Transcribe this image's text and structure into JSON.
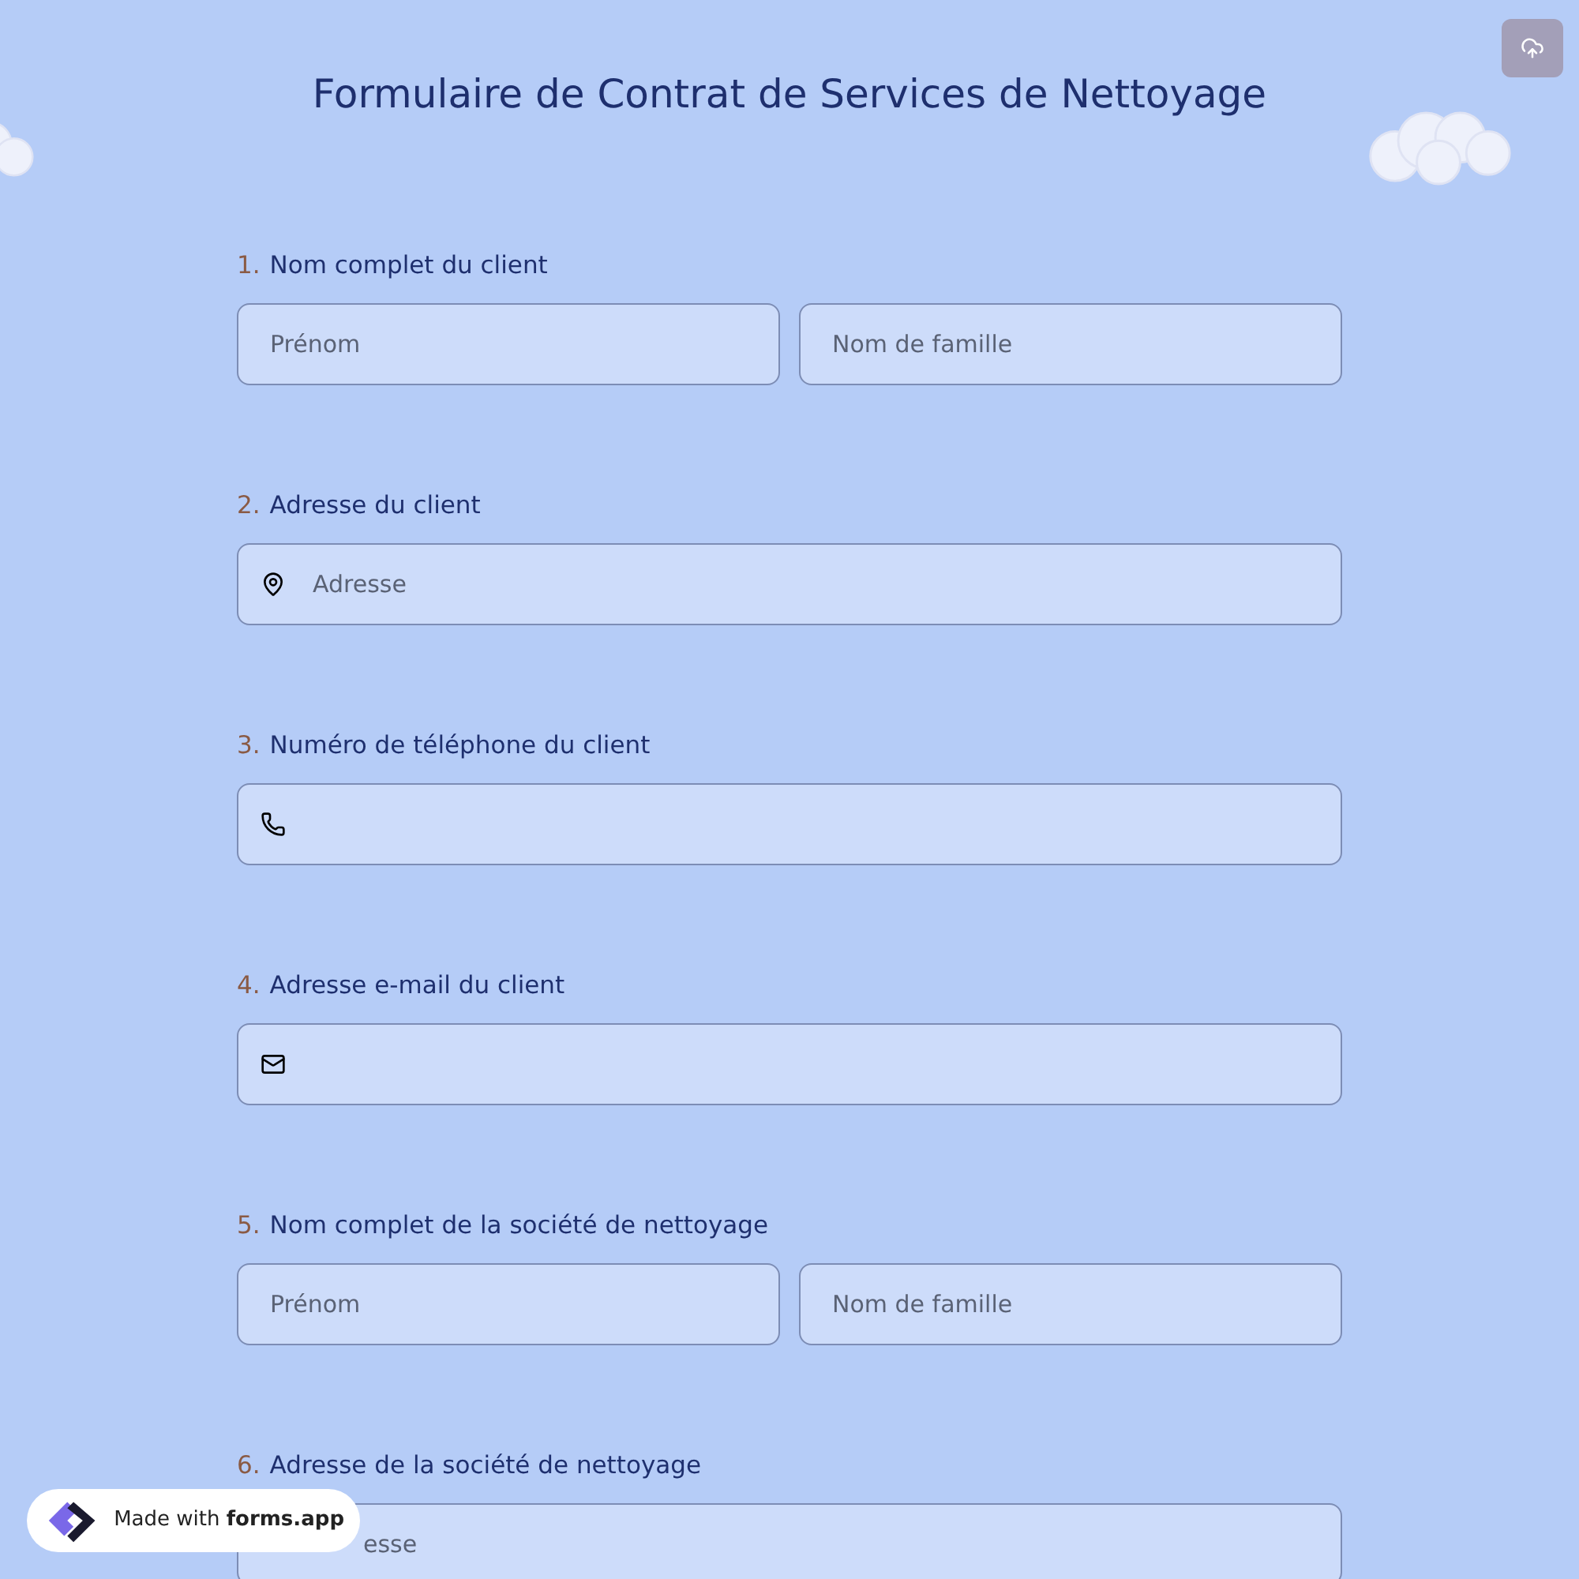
{
  "title": "Formulaire de Contrat de Services de Nettoyage",
  "questions": [
    {
      "number": "1.",
      "label": "Nom complet du client",
      "kind": "name",
      "placeholders": [
        "Prénom",
        "Nom de famille"
      ]
    },
    {
      "number": "2.",
      "label": "Adresse du client",
      "kind": "address",
      "placeholder": "Adresse"
    },
    {
      "number": "3.",
      "label": "Numéro de téléphone du client",
      "kind": "phone"
    },
    {
      "number": "4.",
      "label": "Adresse e-mail du client",
      "kind": "email"
    },
    {
      "number": "5.",
      "label": "Nom complet de la société de nettoyage",
      "kind": "name",
      "placeholders": [
        "Prénom",
        "Nom de famille"
      ]
    },
    {
      "number": "6.",
      "label": "Adresse de la société de nettoyage",
      "kind": "covered",
      "placeholder": "esse"
    }
  ],
  "badge": {
    "prefix": "Made with",
    "brand": "forms.app"
  }
}
